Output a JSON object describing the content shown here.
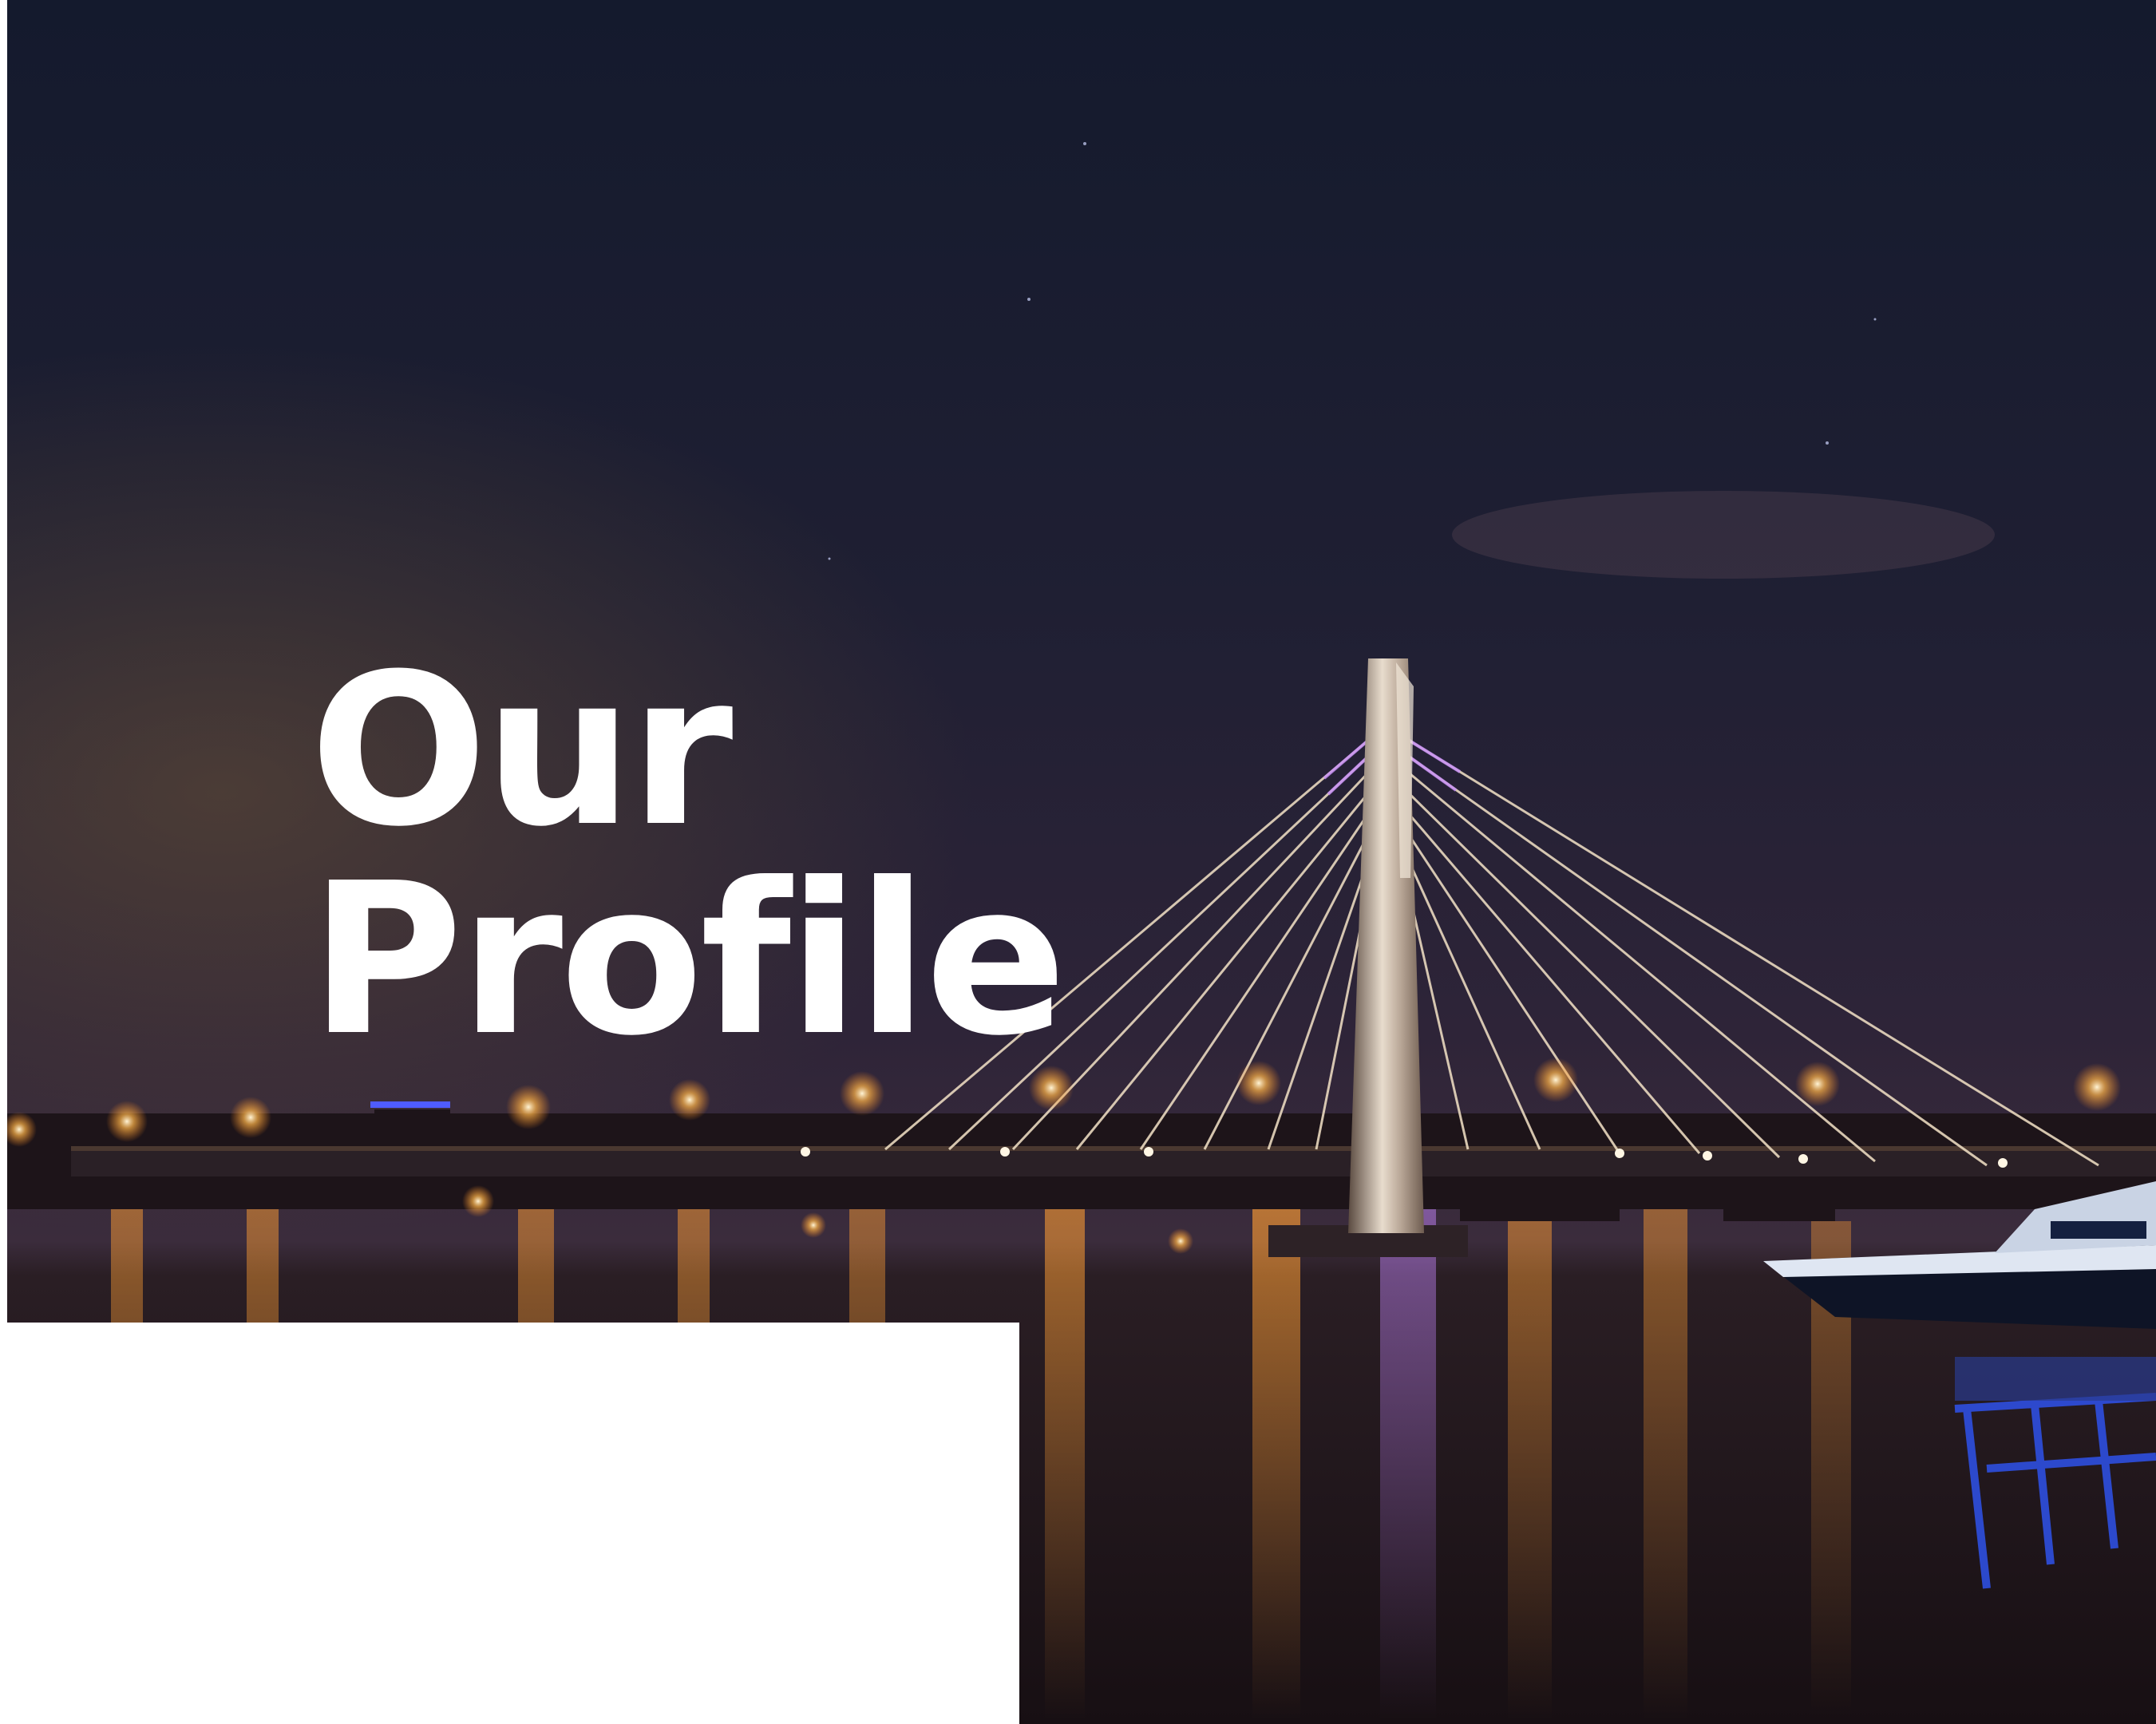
{
  "title": {
    "line1": "Our",
    "line2": "Profile"
  },
  "colors": {
    "sky_top": "#151b2f",
    "sky_mid": "#2b2238",
    "sky_horizon": "#4a3440",
    "water": "#1a1216",
    "light_orange": "#ffb347",
    "cable_white": "#f6ead8",
    "cable_violet": "#c88cff",
    "pylon": "#cfc2b4",
    "boat_blue": "#2e4fe0",
    "panel": "#ffffff",
    "title_text": "#ffffff"
  }
}
